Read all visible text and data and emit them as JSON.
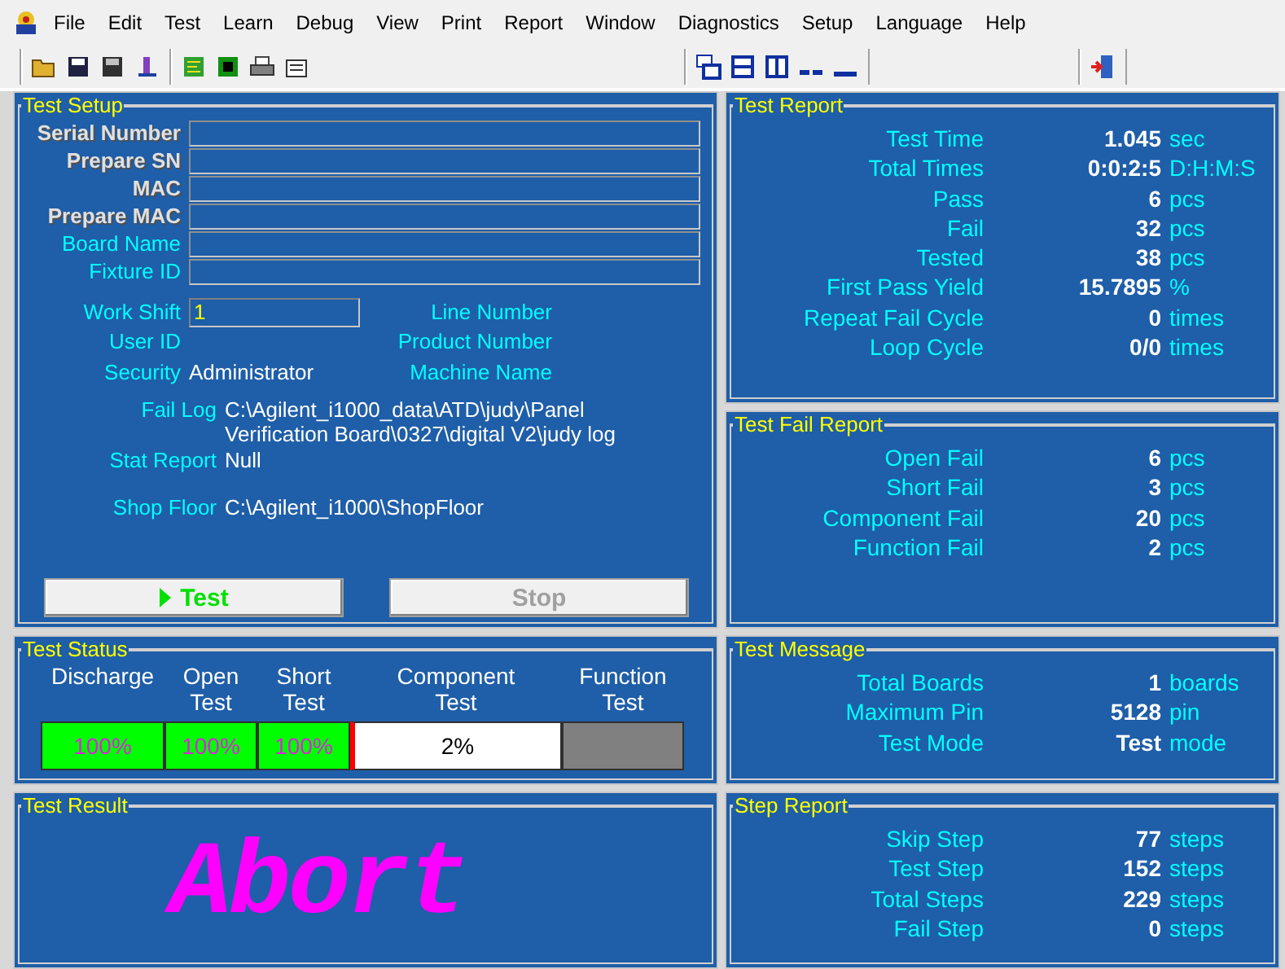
{
  "menu": [
    "File",
    "Edit",
    "Test",
    "Learn",
    "Debug",
    "View",
    "Print",
    "Report",
    "Window",
    "Diagnostics",
    "Setup",
    "Language",
    "Help"
  ],
  "test_setup": {
    "title": "Test Setup",
    "fields": [
      {
        "label": "Serial Number",
        "disabled": true
      },
      {
        "label": "Prepare SN",
        "disabled": true
      },
      {
        "label": "MAC",
        "disabled": true
      },
      {
        "label": "Prepare MAC",
        "disabled": true
      },
      {
        "label": "Board Name",
        "disabled": false
      },
      {
        "label": "Fixture ID",
        "disabled": false
      }
    ],
    "work_shift": {
      "label": "Work Shift",
      "value": "1"
    },
    "info_left": [
      {
        "label": "User ID"
      },
      {
        "label": "Security",
        "value": "Administrator"
      }
    ],
    "info_right": [
      "Line Number",
      "Product Number",
      "Machine Name"
    ],
    "paths": [
      {
        "label": "Fail Log",
        "value": "C:\\Agilent_i1000_data\\ATD\\judy\\Panel Verification Board\\0327\\digital  V2\\judy  log"
      },
      {
        "label": "Stat Report",
        "value": "Null"
      },
      {
        "label": "Shop Floor",
        "value": "C:\\Agilent_i1000\\ShopFloor"
      }
    ],
    "buttons": [
      {
        "label": "Test",
        "disabled": false
      },
      {
        "label": "Stop",
        "disabled": true
      }
    ]
  },
  "test_report": {
    "title": "Test Report",
    "rows": [
      {
        "label": "Test Time",
        "value": "1.045",
        "unit": "sec"
      },
      {
        "label": "Total Times",
        "value": "0:0:2:5",
        "unit": "D:H:M:S"
      },
      {
        "label": "Pass",
        "value": "6",
        "unit": "pcs"
      },
      {
        "label": "Fail",
        "value": "32",
        "unit": "pcs"
      },
      {
        "label": "Tested",
        "value": "38",
        "unit": "pcs"
      },
      {
        "label": "First Pass Yield",
        "value": "15.7895",
        "unit": "%"
      },
      {
        "label": "Repeat Fail Cycle",
        "value": "0",
        "unit": "times"
      },
      {
        "label": "Loop Cycle",
        "value": "0/0",
        "unit": "times"
      }
    ]
  },
  "test_fail_report": {
    "title": "Test Fail Report",
    "rows": [
      {
        "label": "Open Fail",
        "value": "6",
        "unit": "pcs"
      },
      {
        "label": "Short Fail",
        "value": "3",
        "unit": "pcs"
      },
      {
        "label": "Component Fail",
        "value": "20",
        "unit": "pcs"
      },
      {
        "label": "Function Fail",
        "value": "2",
        "unit": "pcs"
      }
    ]
  },
  "test_status": {
    "title": "Test Status",
    "stages": [
      {
        "label": "Discharge",
        "value": "100%",
        "complete": true,
        "running": false
      },
      {
        "label": "Open Test",
        "value": "100%",
        "complete": true,
        "running": false
      },
      {
        "label": "Short Test",
        "value": "100%",
        "complete": true,
        "running": false
      },
      {
        "label": "Component Test",
        "value": "2%",
        "complete": false,
        "running": true
      },
      {
        "label": "Function Test",
        "complete": false,
        "running": false
      }
    ]
  },
  "test_message": {
    "title": "Test Message",
    "rows": [
      {
        "label": "Total Boards",
        "value": "1",
        "unit": "boards"
      },
      {
        "label": "Maximum Pin",
        "value": "5128",
        "unit": "pin"
      },
      {
        "label": "Test Mode",
        "value": "Test",
        "unit": "mode"
      }
    ]
  },
  "test_result": {
    "title": "Test Result",
    "result": "Abort"
  },
  "step_report": {
    "title": "Step Report",
    "rows": [
      {
        "label": "Skip Step",
        "value": "77",
        "unit": "steps"
      },
      {
        "label": "Test Step",
        "value": "152",
        "unit": "steps"
      },
      {
        "label": "Total Steps",
        "value": "229",
        "unit": "steps"
      },
      {
        "label": "Fail Step",
        "value": "0",
        "unit": "steps"
      }
    ]
  }
}
